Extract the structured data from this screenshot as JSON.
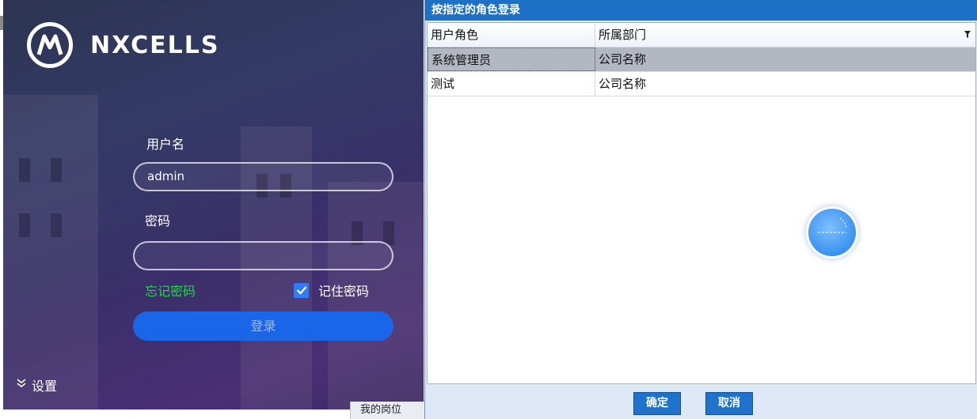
{
  "login": {
    "brand": "NXCELLS",
    "username_label": "用户名",
    "username_value": "admin",
    "password_label": "密码",
    "password_value": "",
    "forgot_password": "忘记密码",
    "remember_password": "记住密码",
    "remember_checked": true,
    "login_button": "登录",
    "settings": "设置"
  },
  "background_tab": "我的岗位",
  "dialog": {
    "title": "按指定的角色登录",
    "columns": [
      "用户角色",
      "所属部门"
    ],
    "rows": [
      {
        "role": "系统管理员",
        "dept": "公司名称"
      },
      {
        "role": "测试",
        "dept": "公司名称"
      }
    ],
    "selected_row": 0,
    "confirm": "确定",
    "cancel": "取消"
  },
  "colors": {
    "accent": "#1f73cc",
    "login_button": "#1a66e8",
    "forgot_link": "#22d84a"
  }
}
